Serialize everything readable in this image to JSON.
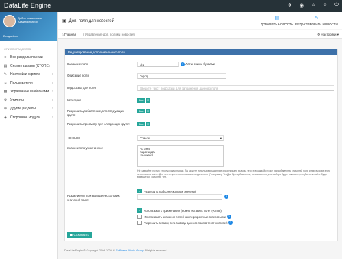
{
  "app": {
    "brand": "DataLife Engine"
  },
  "topbar": {
    "icons": [
      "bell-icon",
      "globe-icon",
      "home-icon",
      "user-icon",
      "logout-icon"
    ],
    "glyphs": [
      "✈",
      "◉",
      "⌂",
      "☺",
      "⏻"
    ]
  },
  "profile": {
    "welcome": "Добро пожаловать",
    "name": "Администратор",
    "login": "Вход:admin"
  },
  "sidebar": {
    "head": "Список разделов",
    "items": [
      {
        "label": "Все разделы панели",
        "icon": "≡",
        "chev": ""
      },
      {
        "label": "Список заказов (STORE)",
        "icon": "▤",
        "chev": ""
      },
      {
        "label": "Настройки скрипта",
        "icon": "✎",
        "chev": "›"
      },
      {
        "label": "Пользователи",
        "icon": "☺",
        "chev": "›"
      },
      {
        "label": "Управление шаблонами",
        "icon": "▦",
        "chev": "›"
      },
      {
        "label": "Утилиты",
        "icon": "⚙",
        "chev": "›"
      },
      {
        "label": "Другие разделы",
        "icon": "⊕",
        "chev": "›"
      },
      {
        "label": "Сторонние модули",
        "icon": "◈",
        "chev": "›"
      }
    ]
  },
  "header": {
    "title": "Доп. поля для новостей",
    "btn_add": "ДОБАВИТЬ НОВОСТЬ",
    "btn_edit": "РЕДАКТИРОВАТЬ НОВОСТИ"
  },
  "breadcrumb": {
    "home": "Главная",
    "current": "Управление доп. полями новостей",
    "settings": "Настройки"
  },
  "panel": {
    "title": "Редактирование дополнительного поля"
  },
  "form": {
    "name_label": "Название поля",
    "name_value": "city",
    "latin_label": "Латинскими буквами",
    "desc_label": "Описание поля",
    "desc_value": "Город",
    "hint_label": "Подсказка для поля",
    "hint_placeholder": "Введите текст подсказки для заполнения данного поля",
    "category_label": "Категория",
    "category_tag": "Все",
    "allow_add_label": "Разрешить добавление для следующих групп:",
    "allow_add_tag": "Все",
    "allow_view_label": "Разрешить просмотр для следующих групп:",
    "allow_view_tag": "Все",
    "type_label": "Тип поля",
    "type_value": "Список",
    "default_label": "Значения по умолчанию:",
    "list_values": [
      "Астана",
      "Караганда",
      "Шымкент"
    ],
    "list_note": "Не сдавайте пустую строку с значениями. Вы можете использовать данные значения для вывода текста в каждой строке при добавлении значений поля и при выводе этого значения на сайте. Для этого нужно использовать разделитель \"|\" например Yes|Да. При добавлении, пользователю для выбора будет показан пункт Да, а на сайте будет выводиться значение Yes.",
    "multi_label": "Разрешить выбор нескольких значений",
    "sep_label": "Разделитель при выводе нескольких значений поля:",
    "opt_use_label": "Использовать при желании (можно оставить поле пустым)",
    "opt_links_label": "Использовать значения полей как перекрестные гиперссылки",
    "opt_insert_label": "Разрешить вставку тега вывода данного поля в текст новостей",
    "save_label": "Сохранить"
  },
  "footer": {
    "text": "DataLife Engine® Copyright 2004-2020 © ",
    "link": "SoftNews Media Group",
    "rights": " All rights reserved."
  }
}
